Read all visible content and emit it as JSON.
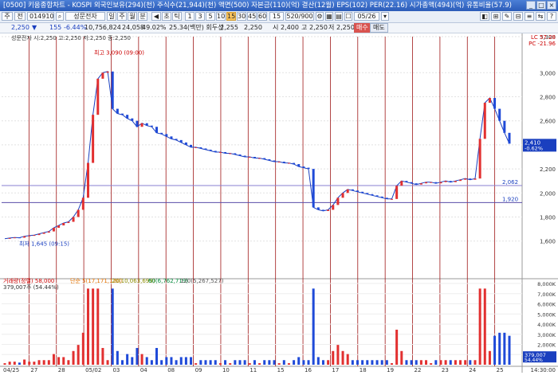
{
  "window": {
    "title": "[0500] 키움종합차트 - KOSPI  외국인보유(294)(천)  주식수(21,944)(천)  액면(500)  자본금(110)(억)  결산(12월)  EPS(102)  PER(22.16)  시가총액(494)(억)  유통비율(57.9)",
    "buttons": [
      "_",
      "□",
      "×"
    ]
  },
  "toolbar": {
    "main_label": "주",
    "sub_label": "전",
    "code": "014910",
    "name": "성문전자",
    "period_buttons": [
      "일",
      "주",
      "월",
      "분"
    ],
    "small_buttons": [
      "◀",
      "초",
      "틱"
    ],
    "intervals": [
      "1",
      "3",
      "5",
      "10",
      "15",
      "30",
      "45",
      "60"
    ],
    "selected_interval": "15",
    "count_value": "15",
    "view_value": "520/900",
    "date_value": "05/26"
  },
  "info": {
    "price": "2,250",
    "arrow": "▼",
    "change": "155",
    "change_pct": "-6.44%",
    "volume": "10,756,824",
    "amount": "24,058",
    "ratio": "49.02%",
    "rate_label": "25.34(백만) 회두선",
    "o_label": "2,255",
    "open_val": "2,250",
    "high_label": "시",
    "high_val": "2,400",
    "low_label": "고",
    "low_val": "2,250",
    "close_label": "저",
    "close_val": "2,250",
    "btn1": "매수",
    "btn2": "매도"
  },
  "chart_data": {
    "type": "candlestick",
    "title": "성문전자 시:2,250 고:2,250 저:2,250 종:2,250",
    "price_axis": {
      "range": [
        1300,
        3300
      ],
      "ticks": [
        "3,300",
        "3,000",
        "2,800",
        "2,600",
        "2,400",
        "2,200",
        "2,000",
        "1,800",
        "1,600"
      ],
      "header": [
        "LC 57.28",
        "PC -21.96"
      ]
    },
    "horizontal_lines": [
      {
        "value": 2062,
        "label": "2,062"
      },
      {
        "value": 1920,
        "label": "1,920"
      }
    ],
    "last_price_tag": {
      "value": "2,410",
      "pct": "-0.62%"
    },
    "annotations": [
      {
        "text": "최고 3,090 (09:00)"
      },
      {
        "text": "최저 1,645 (09:15)"
      }
    ],
    "volume_legend": [
      "거래량(정렬) 58,000",
      "단순 5(17,171,120)",
      "20(10,063,699)",
      "60(6,762,719)",
      "120(5,267,527)"
    ],
    "volume_sub": "379,007주 (54.44%)",
    "volume_axis": {
      "range": [
        0,
        8000000
      ],
      "ticks": [
        "8,000K",
        "7,000K",
        "6,000K",
        "5,000K",
        "4,000K",
        "3,000K",
        "2,000K",
        "1,000K"
      ],
      "last": [
        "379,007",
        "54.44%"
      ]
    },
    "x_labels": [
      "04/25",
      "27",
      "28",
      "05/02",
      "03",
      "04",
      "08",
      "09",
      "10",
      "11",
      "15",
      "16",
      "17",
      "18",
      "19",
      "22",
      "23",
      "24",
      "25"
    ],
    "time_readout": "14:30:00",
    "series": [
      {
        "name": "price",
        "values": [
          1620,
          1625,
          1630,
          1628,
          1640,
          1645,
          1650,
          1660,
          1670,
          1680,
          1710,
          1730,
          1750,
          1760,
          1800,
          1860,
          1960,
          2250,
          2650,
          2950,
          3000,
          3010,
          2700,
          2660,
          2650,
          2620,
          2600,
          2550,
          2580,
          2560,
          2550,
          2500,
          2490,
          2470,
          2450,
          2440,
          2420,
          2400,
          2380,
          2380,
          2370,
          2360,
          2350,
          2340,
          2340,
          2330,
          2330,
          2320,
          2310,
          2300,
          2300,
          2290,
          2290,
          2280,
          2270,
          2260,
          2260,
          2250,
          2250,
          2240,
          2220,
          2210,
          2200,
          1880,
          1860,
          1850,
          1860,
          1900,
          1960,
          2000,
          2030,
          2020,
          2010,
          2000,
          1990,
          1980,
          1970,
          1960,
          1950,
          1950,
          2060,
          2100,
          2090,
          2080,
          2070,
          2080,
          2090,
          2090,
          2080,
          2090,
          2100,
          2090,
          2100,
          2110,
          2120,
          2110,
          2120,
          2450,
          2750,
          2790,
          2700,
          2600,
          2500,
          2410
        ]
      }
    ]
  }
}
